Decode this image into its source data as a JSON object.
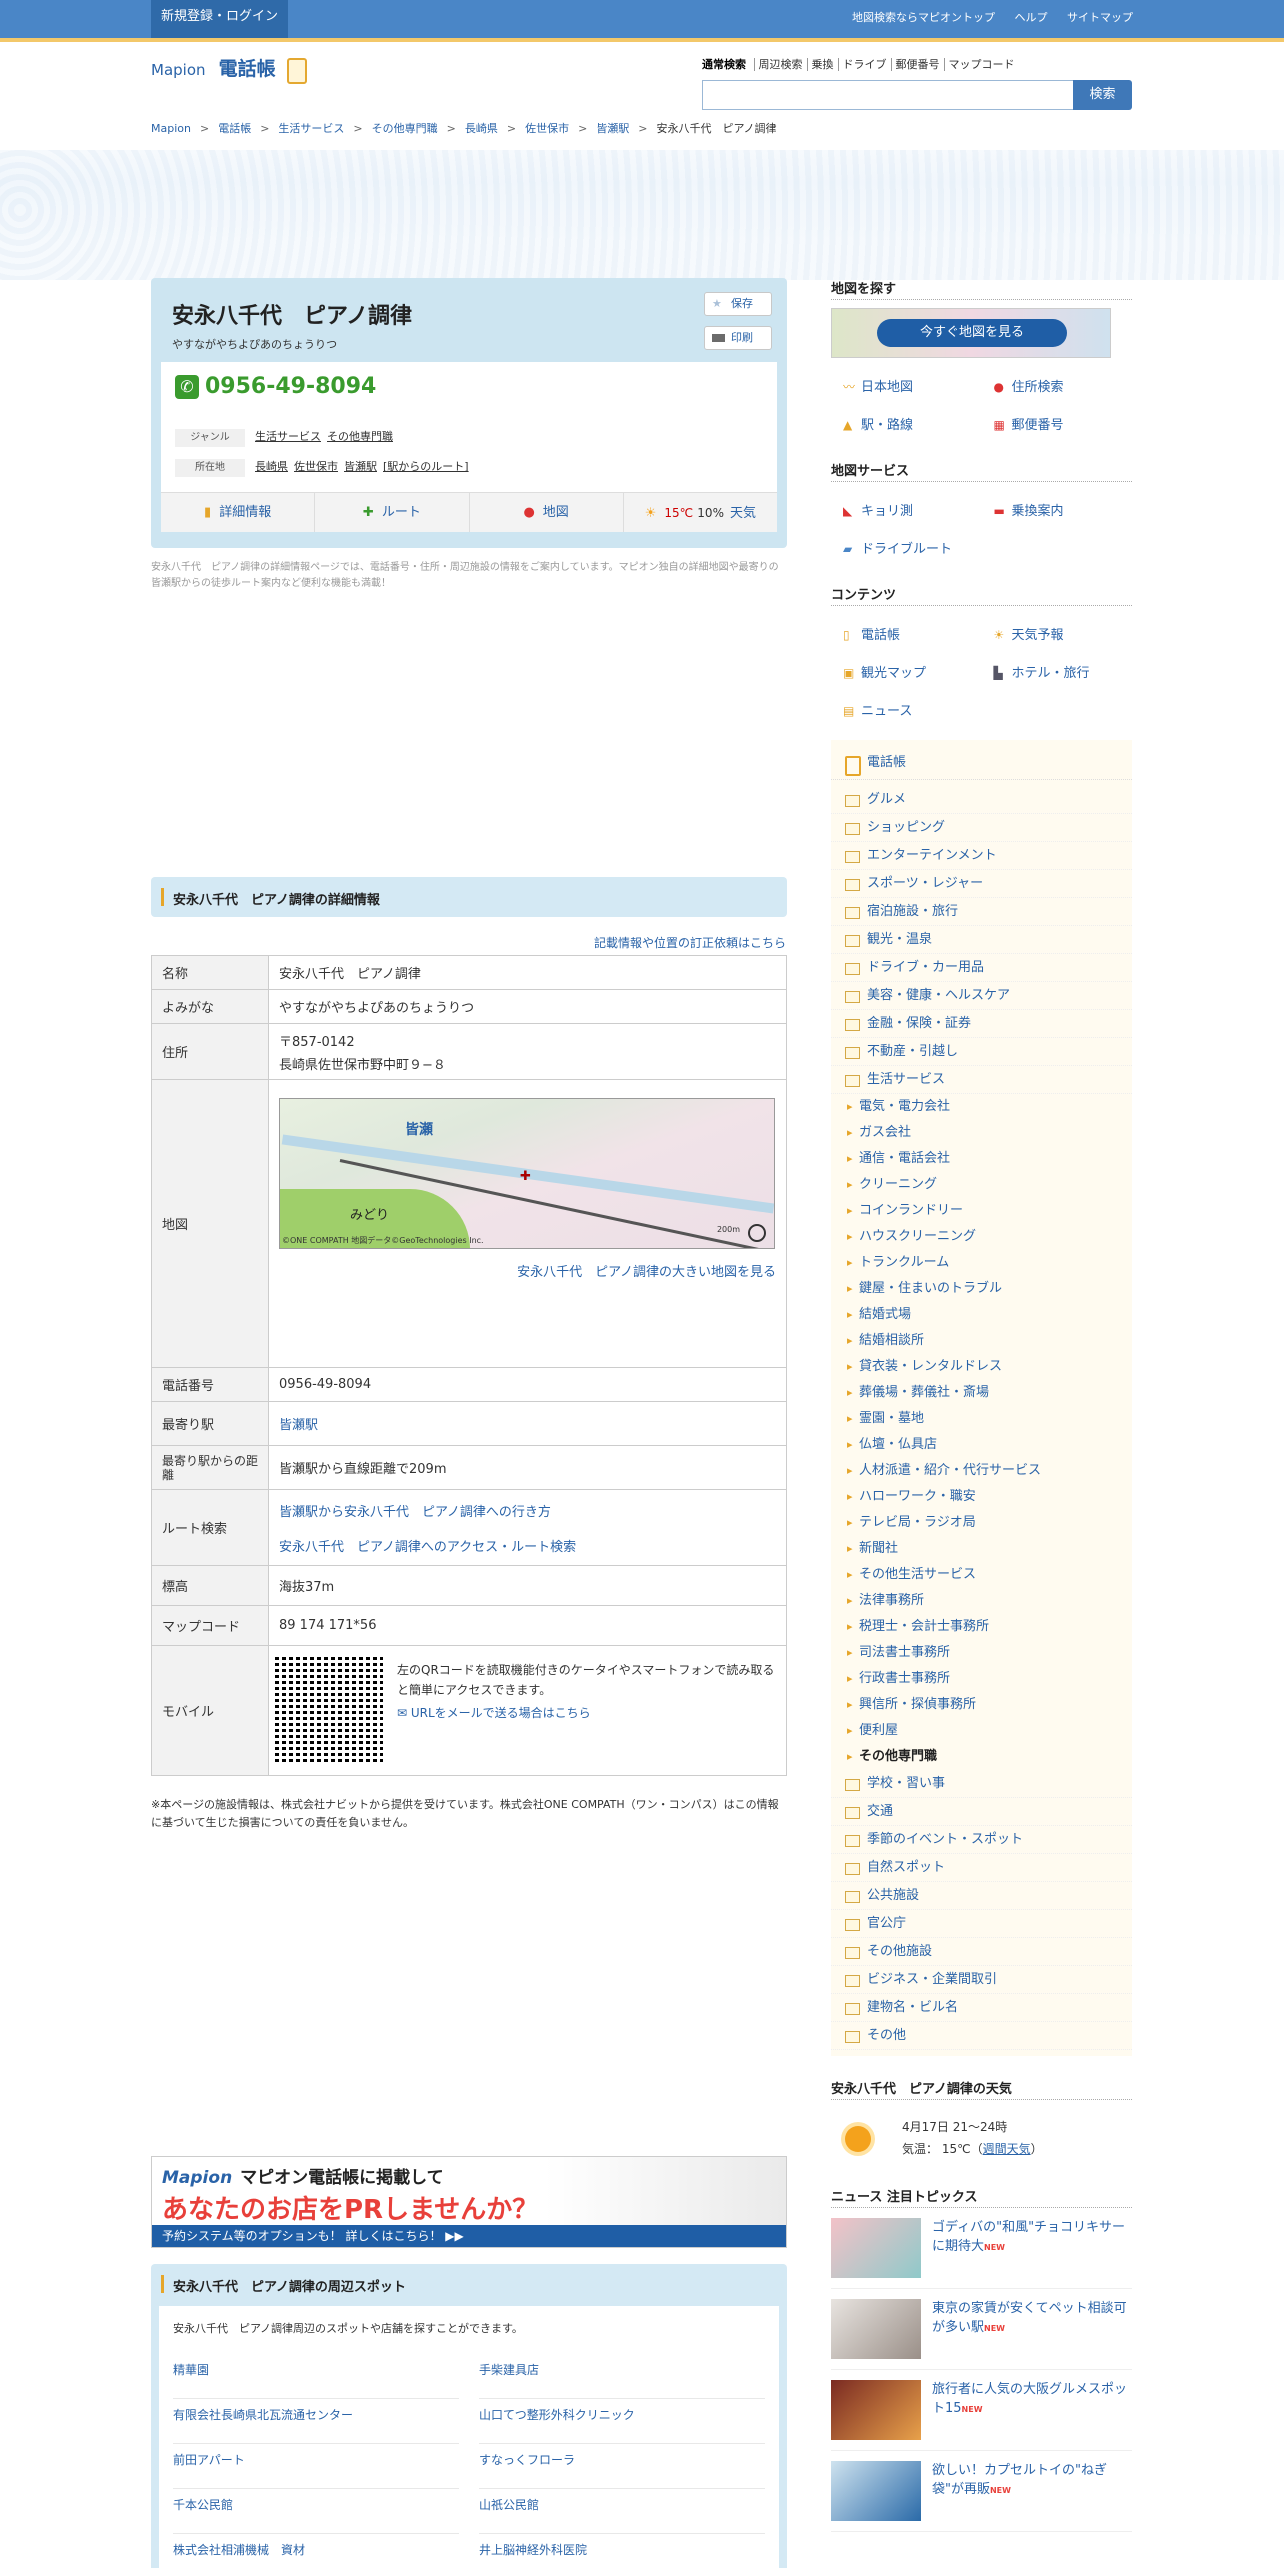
{
  "topbar": {
    "login": "新規登録・ログイン",
    "links": [
      "地図検索ならマピオントップ",
      "ヘルプ",
      "サイトマップ"
    ]
  },
  "header": {
    "logo_alt": "Mapion",
    "logo_section": "電話帳",
    "search_tabs": [
      "通常検索",
      "周辺検索",
      "乗換",
      "ドライブ",
      "郵便番号",
      "マップコード"
    ],
    "search_placeholder": "",
    "search_button": "検索"
  },
  "breadcrumb": [
    "Mapion",
    "電話帳",
    "生活サービス",
    "その他専門職",
    "長崎県",
    "佐世保市",
    "皆瀬駅",
    "安永八千代　ピアノ調律"
  ],
  "place": {
    "name": "安永八千代　ピアノ調律",
    "ruby": "やすながやちよぴあのちょうりつ",
    "save": "保存",
    "print": "印刷",
    "phone": "0956-49-8094",
    "genre_label": "ジャンル",
    "genres": [
      "生活サービス",
      "その他専門職"
    ],
    "addr_label": "所在地",
    "addr_links": [
      "長崎県",
      "佐世保市",
      "皆瀬駅",
      "[駅からのルート]"
    ],
    "tabs": [
      "詳細情報",
      "ルート",
      "地図",
      "天気"
    ],
    "weather_tab": {
      "temp": "15℃",
      "rain": "10%"
    },
    "description": "安永八千代　ピアノ調律の詳細情報ページでは、電話番号・住所・周辺施設の情報をご案内しています。マピオン独自の詳細地図や最寄りの皆瀬駅からの徒歩ルート案内など便利な機能も満載！"
  },
  "detail": {
    "heading": "安永八千代　ピアノ調律の詳細情報",
    "correction": "記載情報や位置の訂正依頼はこちら",
    "rows": {
      "name_label": "名称",
      "name": "安永八千代　ピアノ調律",
      "yomi_label": "よみがな",
      "yomi": "やすながやちよぴあのちょうりつ",
      "addr_label": "住所",
      "zip": "〒857-0142",
      "addr": "長崎県佐世保市野中町９−８",
      "map_label": "地図",
      "map_station": "皆瀬",
      "map_area": "みどり",
      "map_copy": "©ONE COMPATH 地図データ©GeoTechnologies Inc.",
      "map_scale": "200m",
      "big_map": "安永八千代　ピアノ調律の大きい地図を見る",
      "tel_label": "電話番号",
      "tel": "0956-49-8094",
      "station_label": "最寄り駅",
      "station": "皆瀬駅",
      "dist_label": "最寄り駅からの距離",
      "dist": "皆瀬駅から直線距離で209m",
      "route_label": "ルート検索",
      "route1": "皆瀬駅から安永八千代　ピアノ調律への行き方",
      "route2": "安永八千代　ピアノ調律へのアクセス・ルート検索",
      "elev_label": "標高",
      "elev": "海抜37m",
      "mapcode_label": "マップコード",
      "mapcode": "89 174 171*56",
      "mobile_label": "モバイル",
      "mobile_text": "左のQRコードを読取機能付きのケータイやスマートフォンで読み取ると簡単にアクセスできます。",
      "mobile_mail": "URLをメールで送る場合はこちら"
    },
    "note": "※本ページの施設情報は、株式会社ナビットから提供を受けています。株式会社ONE COMPATH（ワン・コンパス）はこの情報に基づいて生じた損害についての責任を負いません。"
  },
  "banner": {
    "brand": "Mapion",
    "line1": "マピオン電話帳に掲載して",
    "line2": "あなたのお店をPRしませんか？",
    "line3": "予約システム等のオプションも！ 詳しくはこちら！ ▶▶"
  },
  "nearby": {
    "heading": "安永八千代　ピアノ調律の周辺スポット",
    "intro": "安永八千代　ピアノ調律周辺のスポットや店舗を探すことができます。",
    "items": [
      "精華園",
      "手柴建具店",
      "有限会社長崎県北瓦流通センター",
      "山口てつ整形外科クリニック",
      "前田アパート",
      "すなっくフローラ",
      "千本公民館",
      "山祇公民館",
      "株式会社相浦機械　資材",
      "井上脳神経外科医院"
    ]
  },
  "sidebar": {
    "find_map": "地図を探す",
    "map_now": "今すぐ地図を見る",
    "find_links": [
      "日本地図",
      "住所検索",
      "駅・路線",
      "郵便番号"
    ],
    "services": "地図サービス",
    "service_links": [
      "キョリ測",
      "乗換案内",
      "ドライブルート"
    ],
    "contents": "コンテンツ",
    "content_links": [
      "電話帳",
      "天気予報",
      "観光マップ",
      "ホテル・旅行",
      "ニュース"
    ],
    "cat_head": "電話帳",
    "cats_a": [
      "グルメ",
      "ショッピング",
      "エンターテインメント",
      "スポーツ・レジャー",
      "宿泊施設・旅行",
      "観光・温泉",
      "ドライブ・カー用品",
      "美容・健康・ヘルスケア",
      "金融・保険・証券",
      "不動産・引越し",
      "生活サービス"
    ],
    "subs": [
      "電気・電力会社",
      "ガス会社",
      "通信・電話会社",
      "クリーニング",
      "コインランドリー",
      "ハウスクリーニング",
      "トランクルーム",
      "鍵屋・住まいのトラブル",
      "結婚式場",
      "結婚相談所",
      "貸衣装・レンタルドレス",
      "葬儀場・葬儀社・斎場",
      "霊園・墓地",
      "仏壇・仏具店",
      "人材派遣・紹介・代行サービス",
      "ハローワーク・職安",
      "テレビ局・ラジオ局",
      "新聞社",
      "その他生活サービス",
      "法律事務所",
      "税理士・会計士事務所",
      "司法書士事務所",
      "行政書士事務所",
      "興信所・探偵事務所",
      "便利屋",
      "その他専門職"
    ],
    "cats_b": [
      "学校・習い事",
      "交通",
      "季節のイベント・スポット",
      "自然スポット",
      "公共施設",
      "官公庁",
      "その他施設",
      "ビジネス・企業間取引",
      "建物名・ビル名",
      "その他"
    ],
    "weather_head": "安永八千代　ピアノ調律の天気",
    "weather_date": "4月17日 21～24時",
    "weather_temp_label": "気温：",
    "weather_temp": "15℃",
    "weather_week": "週間天気",
    "news_head": "ニュース 注目トピックス",
    "news": [
      "ゴディバの\"和風\"チョコリキサーに期待大",
      "東京の家賃が安くてペット相談可が多い駅",
      "旅行者に人気の大阪グルメスポット15",
      "欲しい！カプセルトイの\"ねぎ袋\"が再販"
    ],
    "new_badge": "NEW"
  }
}
